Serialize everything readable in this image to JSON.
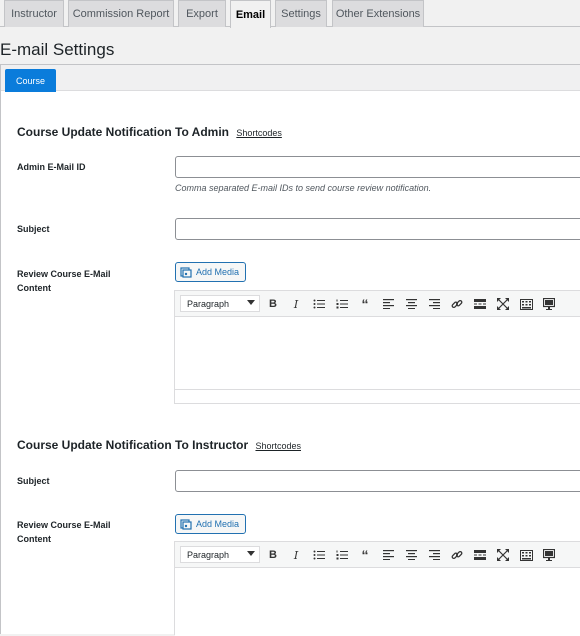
{
  "nav_tabs": [
    {
      "label": "Instructor",
      "active": false
    },
    {
      "label": "Commission Report",
      "active": false
    },
    {
      "label": "Export",
      "active": false
    },
    {
      "label": "Email",
      "active": true
    },
    {
      "label": "Settings",
      "active": false
    },
    {
      "label": "Other Extensions",
      "active": false
    }
  ],
  "page_title": "E-mail Settings",
  "sub_tabs": [
    {
      "label": "Course",
      "active": true
    }
  ],
  "admin_section": {
    "title": "Course Update Notification To Admin",
    "shortcodes_link": "Shortcodes",
    "email_label": "Admin E-Mail ID",
    "email_value": "",
    "email_description": "Comma separated E-mail IDs to send course review notification.",
    "subject_label": "Subject",
    "subject_value": "",
    "content_label": "Review Course E-Mail Content",
    "add_media_label": "Add Media",
    "format_select": "Paragraph"
  },
  "instructor_section": {
    "title": "Course Update Notification To Instructor",
    "shortcodes_link": "Shortcodes",
    "subject_label": "Subject",
    "subject_value": "",
    "content_label": "Review Course E-Mail Content",
    "add_media_label": "Add Media",
    "format_select": "Paragraph"
  },
  "toolbar_icons": [
    "bold-icon",
    "italic-icon",
    "bullet-list-icon",
    "numbered-list-icon",
    "blockquote-icon",
    "align-left-icon",
    "align-center-icon",
    "align-right-icon",
    "link-icon",
    "read-more-icon",
    "fullscreen-icon",
    "toolbar-toggle-icon",
    "preview-icon"
  ],
  "colors": {
    "accent": "#0a7cdb",
    "link": "#2271b1"
  }
}
